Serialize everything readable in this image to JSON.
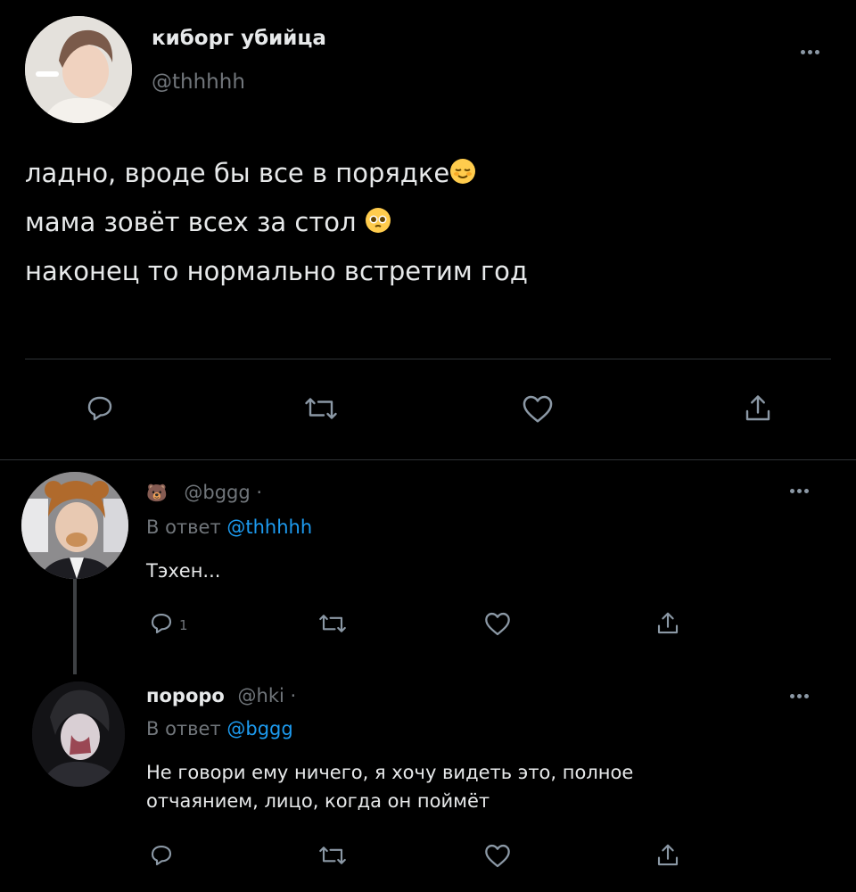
{
  "main_tweet": {
    "display_name": "киборг убийца",
    "handle": "@thhhhh",
    "lines": [
      "ладно, вроде бы все в порядке",
      "мама зовёт всех за стол",
      "наконец то нормально встретим год"
    ],
    "emojis": [
      "relieved-face",
      "pleading-face"
    ]
  },
  "replies": [
    {
      "name_emoji": "🐻",
      "handle": "@bggg",
      "separator": "·",
      "reply_prefix": "В ответ",
      "reply_to": "@thhhhh",
      "text": "Тэхен...",
      "reply_count": "1"
    },
    {
      "display_name": "пороро",
      "handle": "@hki",
      "separator": "·",
      "reply_prefix": "В ответ",
      "reply_to": "@bggg",
      "text_lines": [
        "Не говори ему ничего, я хочу видеть это, полное",
        "отчаянием, лицо, когда он поймёт"
      ]
    }
  ],
  "colors": {
    "background": "#000000",
    "text": "#e7e9ea",
    "muted": "#71767b",
    "link": "#1d9bf0",
    "divider": "#2f3336"
  },
  "icons": [
    "reply-icon",
    "retweet-icon",
    "like-icon",
    "share-icon",
    "more-icon"
  ]
}
